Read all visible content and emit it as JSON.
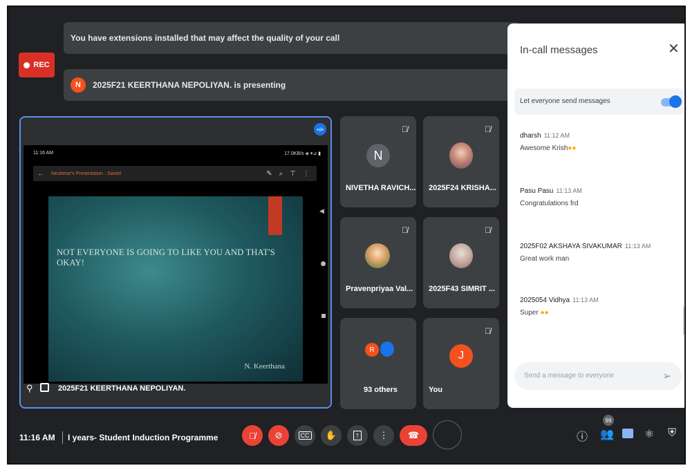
{
  "banners": {
    "extensions": "You have extensions installed that may affect the quality of your call",
    "presenting": "2025F21 KEERTHANA NEPOLIYAN. is presenting",
    "presenter_initial": "N"
  },
  "rec_label": "REC",
  "main": {
    "phone_time": "11:16 AM",
    "phone_status_right": "17.0KB/s ◈ ▾⊿ ▮",
    "phone_title": "Nesherar's Presentation · Saved",
    "slide_text": "NOT EVERYONE IS GOING TO LIKE YOU AND THAT'S OKAY!",
    "slide_signature": "N. Keerthana",
    "presenter_name": "2025F21 KEERTHANA NEPOLIYAN."
  },
  "tiles": [
    {
      "name": "NIVETHA RAVICH...",
      "initial": "N"
    },
    {
      "name": "2025F24 KRISHA..."
    },
    {
      "name": "Pravenpriyaa Val..."
    },
    {
      "name": "2025F43 SIMRIT ..."
    },
    {
      "name": "93 others",
      "initial": "R"
    },
    {
      "name": "You",
      "initial": "J"
    }
  ],
  "panel": {
    "title": "In-call messages",
    "toggle_label": "Let everyone send messages",
    "messages": [
      {
        "sender": "dharsh",
        "time": "11:12 AM",
        "text": "Awesome Krish"
      },
      {
        "sender": "Pasu Pasu",
        "time": "11:13 AM",
        "text": "Congratulations frd"
      },
      {
        "sender": "2025F02 AKSHAYA SIVAKUMAR",
        "time": "11:13 AM",
        "text": "Great work man"
      },
      {
        "sender": "2025054 Vidhya",
        "time": "11:13 AM",
        "text": "Super"
      }
    ],
    "input_placeholder": "Send a message to everyone"
  },
  "bottom": {
    "time": "11:16 AM",
    "meeting_title": "I years- Student Induction Programme",
    "people_badge": "99"
  },
  "colors": {
    "accent": "#8ab4f8",
    "danger": "#ea4335",
    "toggle": "#1a73e8"
  }
}
